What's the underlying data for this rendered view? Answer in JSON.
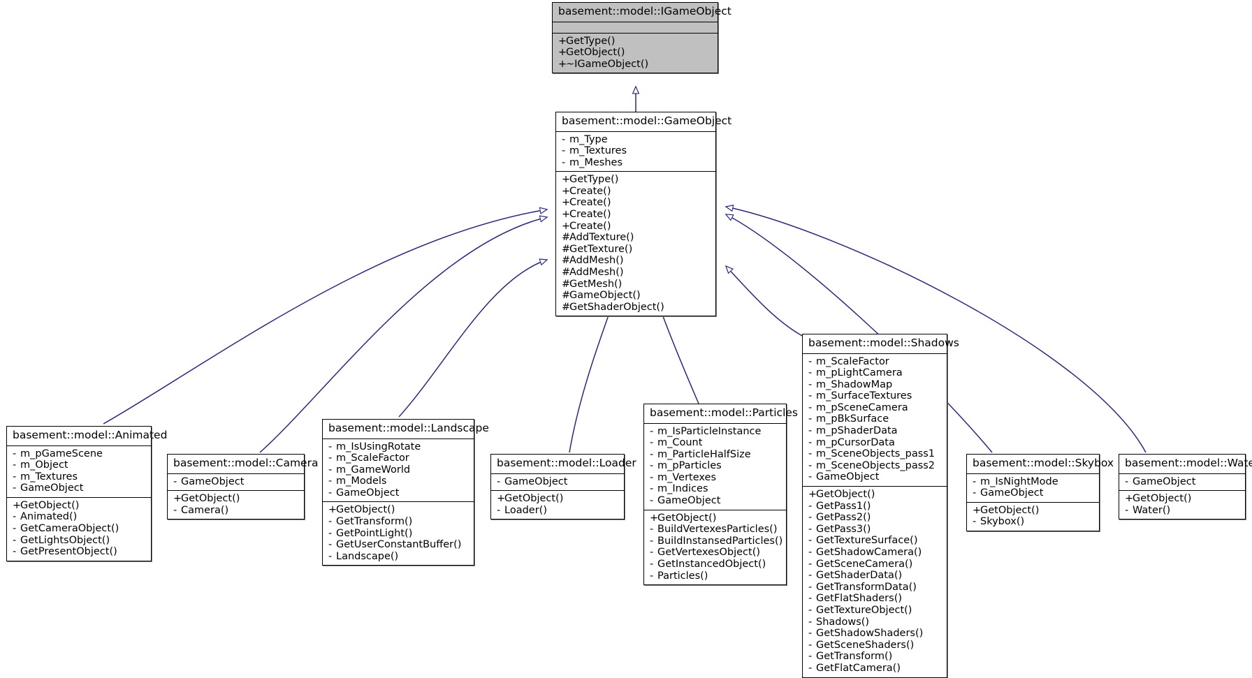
{
  "diagram": {
    "kind": "uml-class-inheritance-diagram",
    "colors": {
      "interface_fill": "#c0c0c0",
      "class_fill": "#ffffff",
      "border": "#000000",
      "edge": "#27287a",
      "shadow": "#808080"
    },
    "visibility_symbols": {
      "public": "+",
      "private": "-",
      "protected": "#"
    }
  },
  "classes": [
    {
      "id": "igameobject",
      "name": "basement::model::IGameObject",
      "is_interface": true,
      "attributes": [],
      "methods": [
        {
          "vis": "+",
          "name": "GetType()"
        },
        {
          "vis": "+",
          "name": "GetObject()"
        },
        {
          "vis": "+",
          "name": "~IGameObject()"
        }
      ]
    },
    {
      "id": "gameobject",
      "name": "basement::model::GameObject",
      "is_interface": false,
      "attributes": [
        {
          "vis": "-",
          "name": "m_Type"
        },
        {
          "vis": "-",
          "name": "m_Textures"
        },
        {
          "vis": "-",
          "name": "m_Meshes"
        }
      ],
      "methods": [
        {
          "vis": "+",
          "name": "GetType()"
        },
        {
          "vis": "+",
          "name": "Create()"
        },
        {
          "vis": "+",
          "name": "Create()"
        },
        {
          "vis": "+",
          "name": "Create()"
        },
        {
          "vis": "+",
          "name": "Create()"
        },
        {
          "vis": "#",
          "name": "AddTexture()"
        },
        {
          "vis": "#",
          "name": "GetTexture()"
        },
        {
          "vis": "#",
          "name": "AddMesh()"
        },
        {
          "vis": "#",
          "name": "AddMesh()"
        },
        {
          "vis": "#",
          "name": "GetMesh()"
        },
        {
          "vis": "#",
          "name": "GameObject()"
        },
        {
          "vis": "#",
          "name": "GetShaderObject()"
        }
      ]
    },
    {
      "id": "animated",
      "name": "basement::model::Animated",
      "is_interface": false,
      "attributes": [
        {
          "vis": "-",
          "name": "m_pGameScene"
        },
        {
          "vis": "-",
          "name": "m_Object"
        },
        {
          "vis": "-",
          "name": "m_Textures"
        },
        {
          "vis": "-",
          "name": "GameObject"
        }
      ],
      "methods": [
        {
          "vis": "+",
          "name": "GetObject()"
        },
        {
          "vis": "-",
          "name": "Animated()"
        },
        {
          "vis": "-",
          "name": "GetCameraObject()"
        },
        {
          "vis": "-",
          "name": "GetLightsObject()"
        },
        {
          "vis": "-",
          "name": "GetPresentObject()"
        }
      ]
    },
    {
      "id": "camera",
      "name": "basement::model::Camera",
      "is_interface": false,
      "attributes": [
        {
          "vis": "-",
          "name": "GameObject"
        }
      ],
      "methods": [
        {
          "vis": "+",
          "name": "GetObject()"
        },
        {
          "vis": "-",
          "name": "Camera()"
        }
      ]
    },
    {
      "id": "landscape",
      "name": "basement::model::Landscape",
      "is_interface": false,
      "attributes": [
        {
          "vis": "-",
          "name": "m_IsUsingRotate"
        },
        {
          "vis": "-",
          "name": "m_ScaleFactor"
        },
        {
          "vis": "-",
          "name": "m_GameWorld"
        },
        {
          "vis": "-",
          "name": "m_Models"
        },
        {
          "vis": "-",
          "name": "GameObject"
        }
      ],
      "methods": [
        {
          "vis": "+",
          "name": "GetObject()"
        },
        {
          "vis": "-",
          "name": "GetTransform()"
        },
        {
          "vis": "-",
          "name": "GetPointLight()"
        },
        {
          "vis": "-",
          "name": "GetUserConstantBuffer()"
        },
        {
          "vis": "-",
          "name": "Landscape()"
        }
      ]
    },
    {
      "id": "loader",
      "name": "basement::model::Loader",
      "is_interface": false,
      "attributes": [
        {
          "vis": "-",
          "name": "GameObject"
        }
      ],
      "methods": [
        {
          "vis": "+",
          "name": "GetObject()"
        },
        {
          "vis": "-",
          "name": "Loader()"
        }
      ]
    },
    {
      "id": "particles",
      "name": "basement::model::Particles",
      "is_interface": false,
      "attributes": [
        {
          "vis": "-",
          "name": "m_IsParticleInstance"
        },
        {
          "vis": "-",
          "name": "m_Count"
        },
        {
          "vis": "-",
          "name": "m_ParticleHalfSize"
        },
        {
          "vis": "-",
          "name": "m_pParticles"
        },
        {
          "vis": "-",
          "name": "m_Vertexes"
        },
        {
          "vis": "-",
          "name": "m_Indices"
        },
        {
          "vis": "-",
          "name": "GameObject"
        }
      ],
      "methods": [
        {
          "vis": "+",
          "name": "GetObject()"
        },
        {
          "vis": "-",
          "name": "BuildVertexesParticles()"
        },
        {
          "vis": "-",
          "name": "BuildInstansedParticles()"
        },
        {
          "vis": "-",
          "name": "GetVertexesObject()"
        },
        {
          "vis": "-",
          "name": "GetInstancedObject()"
        },
        {
          "vis": "-",
          "name": "Particles()"
        }
      ]
    },
    {
      "id": "shadows",
      "name": "basement::model::Shadows",
      "is_interface": false,
      "attributes": [
        {
          "vis": "-",
          "name": "m_ScaleFactor"
        },
        {
          "vis": "-",
          "name": "m_pLightCamera"
        },
        {
          "vis": "-",
          "name": "m_ShadowMap"
        },
        {
          "vis": "-",
          "name": "m_SurfaceTextures"
        },
        {
          "vis": "-",
          "name": "m_pSceneCamera"
        },
        {
          "vis": "-",
          "name": "m_pBkSurface"
        },
        {
          "vis": "-",
          "name": "m_pShaderData"
        },
        {
          "vis": "-",
          "name": "m_pCursorData"
        },
        {
          "vis": "-",
          "name": "m_SceneObjects_pass1"
        },
        {
          "vis": "-",
          "name": "m_SceneObjects_pass2"
        },
        {
          "vis": "-",
          "name": "GameObject"
        }
      ],
      "methods": [
        {
          "vis": "+",
          "name": "GetObject()"
        },
        {
          "vis": "-",
          "name": "GetPass1()"
        },
        {
          "vis": "-",
          "name": "GetPass2()"
        },
        {
          "vis": "-",
          "name": "GetPass3()"
        },
        {
          "vis": "-",
          "name": "GetTextureSurface()"
        },
        {
          "vis": "-",
          "name": "GetShadowCamera()"
        },
        {
          "vis": "-",
          "name": "GetSceneCamera()"
        },
        {
          "vis": "-",
          "name": "GetShaderData()"
        },
        {
          "vis": "-",
          "name": "GetTransformData()"
        },
        {
          "vis": "-",
          "name": "GetFlatShaders()"
        },
        {
          "vis": "-",
          "name": "GetTextureObject()"
        },
        {
          "vis": "-",
          "name": "Shadows()"
        },
        {
          "vis": "-",
          "name": "GetShadowShaders()"
        },
        {
          "vis": "-",
          "name": "GetSceneShaders()"
        },
        {
          "vis": "-",
          "name": "GetTransform()"
        },
        {
          "vis": "-",
          "name": "GetFlatCamera()"
        }
      ]
    },
    {
      "id": "skybox",
      "name": "basement::model::Skybox",
      "is_interface": false,
      "attributes": [
        {
          "vis": "-",
          "name": "m_IsNightMode"
        },
        {
          "vis": "-",
          "name": "GameObject"
        }
      ],
      "methods": [
        {
          "vis": "+",
          "name": "GetObject()"
        },
        {
          "vis": "-",
          "name": "Skybox()"
        }
      ]
    },
    {
      "id": "water",
      "name": "basement::model::Water",
      "is_interface": false,
      "attributes": [
        {
          "vis": "-",
          "name": "GameObject"
        }
      ],
      "methods": [
        {
          "vis": "+",
          "name": "GetObject()"
        },
        {
          "vis": "-",
          "name": "Water()"
        }
      ]
    }
  ],
  "inheritance_edges": [
    {
      "from": "gameobject",
      "to": "igameobject"
    },
    {
      "from": "animated",
      "to": "gameobject"
    },
    {
      "from": "camera",
      "to": "gameobject"
    },
    {
      "from": "landscape",
      "to": "gameobject"
    },
    {
      "from": "loader",
      "to": "gameobject"
    },
    {
      "from": "particles",
      "to": "gameobject"
    },
    {
      "from": "shadows",
      "to": "gameobject"
    },
    {
      "from": "skybox",
      "to": "gameobject"
    },
    {
      "from": "water",
      "to": "gameobject"
    }
  ]
}
